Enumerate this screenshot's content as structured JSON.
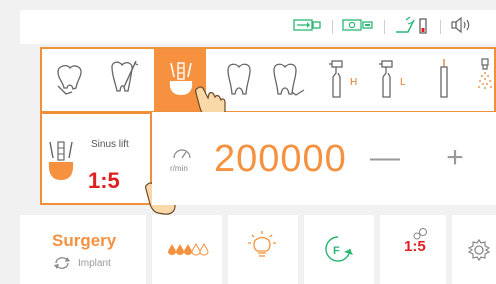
{
  "status": {
    "icons": [
      "usb-icon",
      "motor-icon",
      "water-battery-icon",
      "speaker-icon"
    ]
  },
  "tools": {
    "items": [
      {
        "name": "tooth-cleaning-icon",
        "selected": false
      },
      {
        "name": "root-canal-icon",
        "selected": false
      },
      {
        "name": "implant-icon",
        "selected": true
      },
      {
        "name": "tooth-icon",
        "selected": false
      },
      {
        "name": "crown-icon",
        "selected": false
      },
      {
        "name": "handpiece-high-icon",
        "label": "H",
        "selected": false
      },
      {
        "name": "handpiece-low-icon",
        "label": "L",
        "selected": false
      },
      {
        "name": "scaler-icon",
        "selected": false
      },
      {
        "name": "spray-icon",
        "selected": false
      }
    ]
  },
  "mode": {
    "name": "Sinus lift",
    "ratio": "1:5"
  },
  "speed": {
    "unit": "r/min",
    "value": "200000",
    "minus": "—",
    "plus": "+"
  },
  "program": {
    "name": "Surgery",
    "sub": "Implant"
  },
  "bottom": {
    "water_level": "3 of 5",
    "ratio_label": "1:5"
  },
  "colors": {
    "accent": "#f5913f",
    "ratio": "#e02020",
    "light_green": "#2bb673"
  }
}
